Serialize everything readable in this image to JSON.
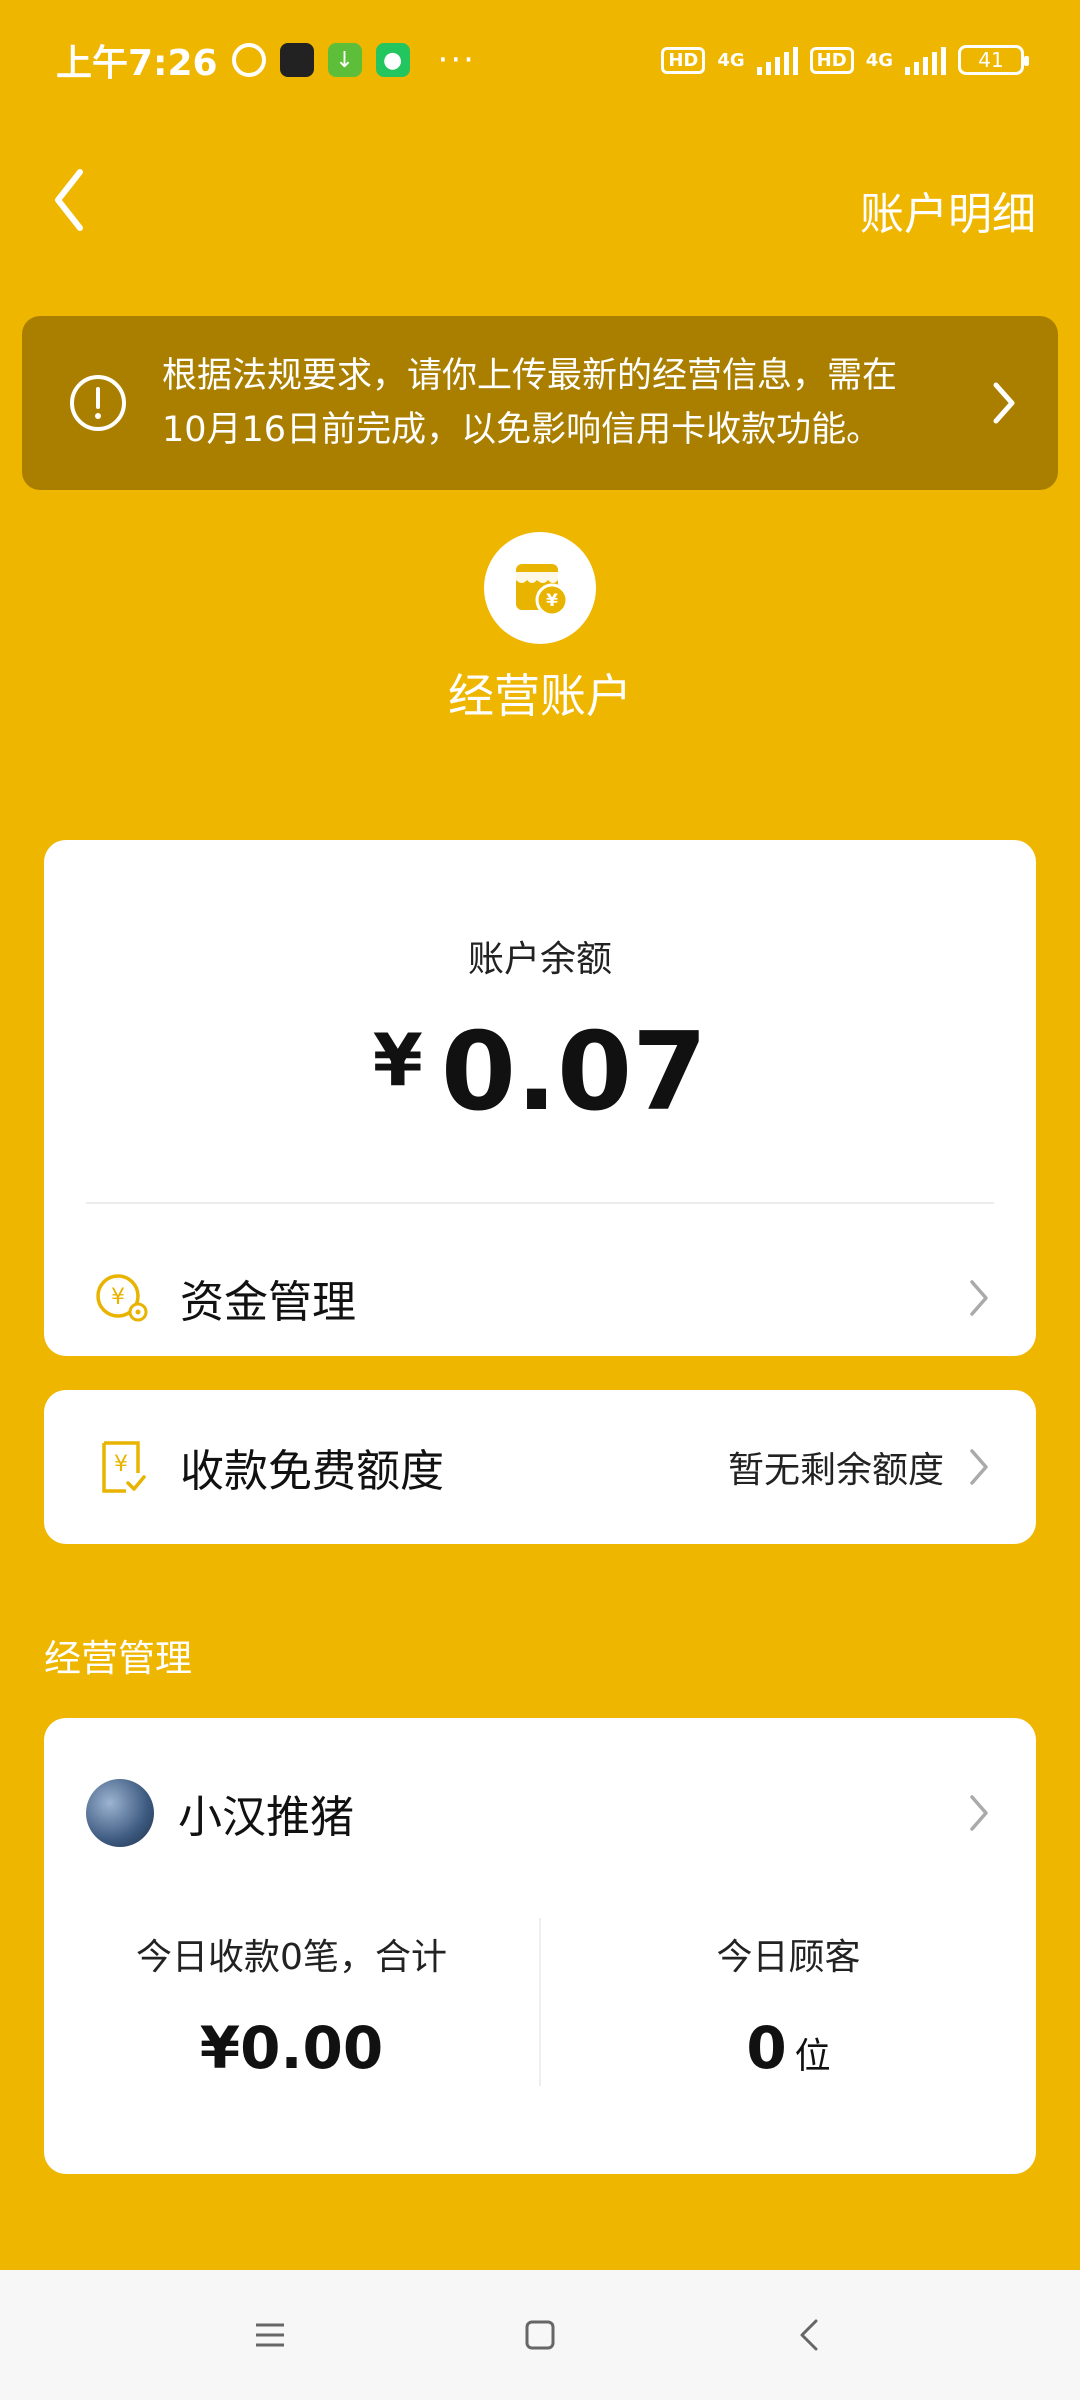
{
  "status_bar": {
    "time": "上午7:26",
    "hd_1": "HD",
    "net_1": "4G",
    "hd_2": "HD",
    "net_2": "4G",
    "battery": "41"
  },
  "nav": {
    "account_detail": "账户明细"
  },
  "notice": {
    "line1": "根据法规要求，请你上传最新的经营信息，需在",
    "line2": "10月16日前完成，以免影响信用卡收款功能。"
  },
  "account": {
    "title": "经营账户"
  },
  "balance_card": {
    "label": "账户余额",
    "currency": "¥",
    "amount": "0.07",
    "funds_management": "资金管理"
  },
  "quota_card": {
    "label": "收款免费额度",
    "status": "暂无剩余额度"
  },
  "business": {
    "section_title": "经营管理",
    "store_name": "小汉推猪",
    "today_receipts_label": "今日收款0笔，合计",
    "today_receipts_amount": "¥0.00",
    "today_customers_label": "今日顾客",
    "today_customers_value": "0",
    "today_customers_unit": "位"
  },
  "colors": {
    "background": "#EFB600",
    "notice_bg": "#AA7F00",
    "card": "#FFFFFF",
    "accent_icon": "#E8B400"
  }
}
